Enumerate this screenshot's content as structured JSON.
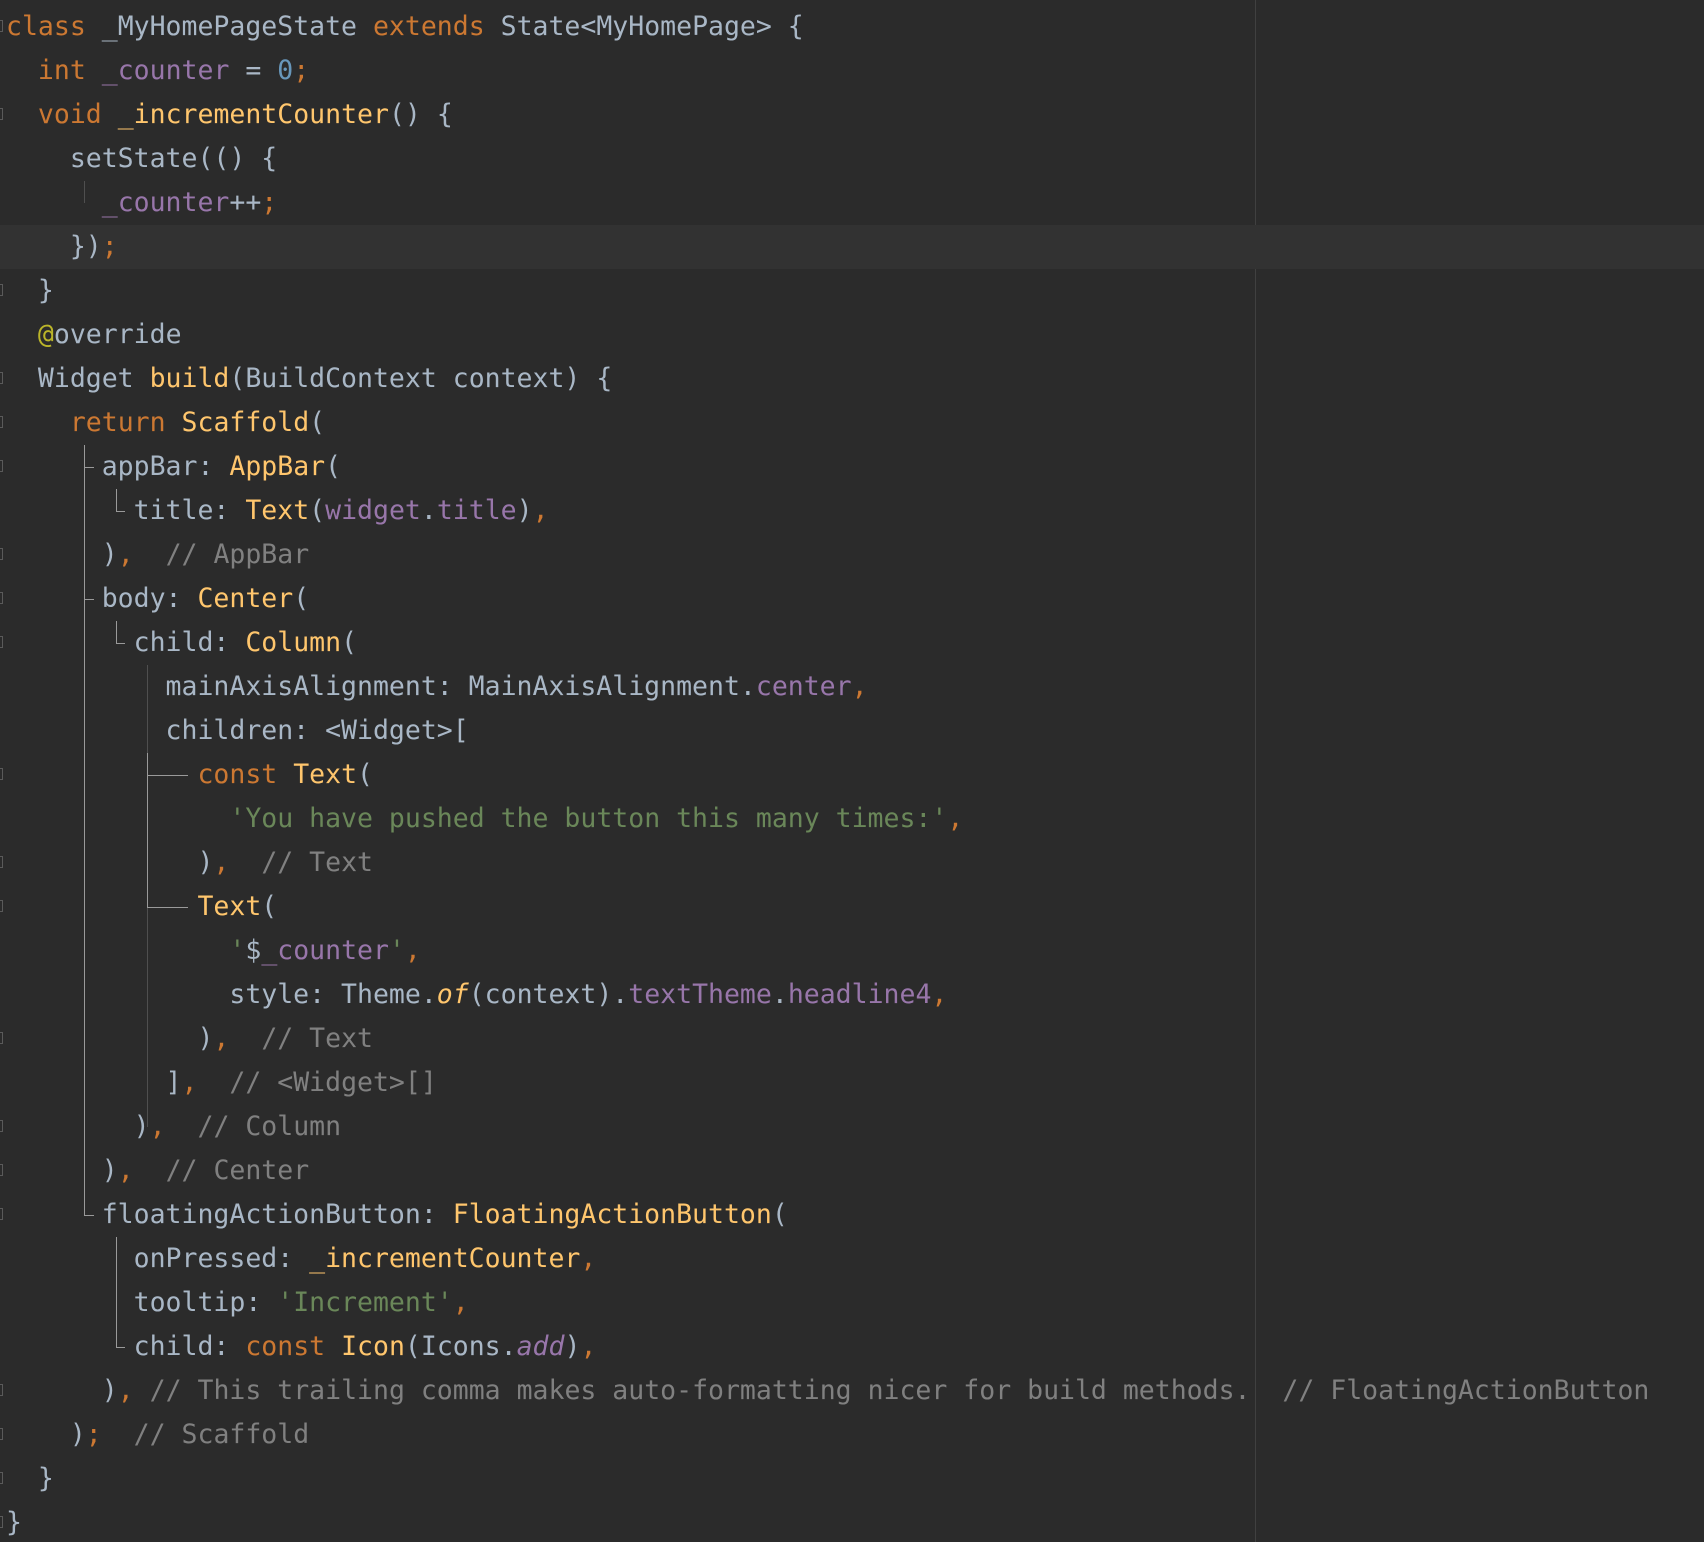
{
  "editor": {
    "language": "Dart",
    "colors": {
      "background": "#2b2b2b",
      "current_line": "#323232",
      "keyword": "#cc7832",
      "function": "#ffc66d",
      "plain": "#a9b7c6",
      "field": "#9876aa",
      "number": "#6897bb",
      "string": "#6a8759",
      "comment": "#808080",
      "annotation": "#bbb529"
    },
    "current_line_index": 5,
    "lines": [
      [
        [
          "kw",
          "class"
        ],
        [
          "pl",
          " _MyHomePageState "
        ],
        [
          "kw",
          "extends"
        ],
        [
          "pl",
          " State<MyHomePage> {"
        ]
      ],
      [
        [
          "pl",
          "  "
        ],
        [
          "kw",
          "int"
        ],
        [
          "pl",
          " "
        ],
        [
          "fd",
          "_counter"
        ],
        [
          "pl",
          " = "
        ],
        [
          "num",
          "0"
        ],
        [
          "kw",
          ";"
        ]
      ],
      [
        [
          "pl",
          "  "
        ],
        [
          "kw",
          "void"
        ],
        [
          "pl",
          " "
        ],
        [
          "fn",
          "_incrementCounter"
        ],
        [
          "pl",
          "() {"
        ]
      ],
      [
        [
          "pl",
          "    setState(() {"
        ]
      ],
      [
        [
          "pl",
          "      "
        ],
        [
          "fd",
          "_counter"
        ],
        [
          "pl",
          "++"
        ],
        [
          "kw",
          ";"
        ]
      ],
      [
        [
          "pl",
          "    })"
        ],
        [
          "kw",
          ";"
        ]
      ],
      [
        [
          "pl",
          "  }"
        ]
      ],
      [
        [
          "pl",
          "  "
        ],
        [
          "ann",
          "@"
        ],
        [
          "pl",
          "override"
        ]
      ],
      [
        [
          "pl",
          "  Widget "
        ],
        [
          "fn",
          "build"
        ],
        [
          "pl",
          "(BuildContext context) {"
        ]
      ],
      [
        [
          "pl",
          "    "
        ],
        [
          "kw",
          "return"
        ],
        [
          "pl",
          " "
        ],
        [
          "fn",
          "Scaffold"
        ],
        [
          "pl",
          "("
        ]
      ],
      [
        [
          "pl",
          "      appBar: "
        ],
        [
          "fn",
          "AppBar"
        ],
        [
          "pl",
          "("
        ]
      ],
      [
        [
          "pl",
          "        title: "
        ],
        [
          "fn",
          "Text"
        ],
        [
          "pl",
          "("
        ],
        [
          "fd",
          "widget"
        ],
        [
          "pl",
          "."
        ],
        [
          "fd",
          "title"
        ],
        [
          "pl",
          ")"
        ],
        [
          "kw",
          ","
        ]
      ],
      [
        [
          "pl",
          "      )"
        ],
        [
          "kw",
          ","
        ],
        [
          "pl",
          "  "
        ],
        [
          "cm",
          "// AppBar"
        ]
      ],
      [
        [
          "pl",
          "      body: "
        ],
        [
          "fn",
          "Center"
        ],
        [
          "pl",
          "("
        ]
      ],
      [
        [
          "pl",
          "        child: "
        ],
        [
          "fn",
          "Column"
        ],
        [
          "pl",
          "("
        ]
      ],
      [
        [
          "pl",
          "          mainAxisAlignment: MainAxisAlignment."
        ],
        [
          "fd",
          "center"
        ],
        [
          "kw",
          ","
        ]
      ],
      [
        [
          "pl",
          "          children: <Widget>["
        ]
      ],
      [
        [
          "pl",
          "            "
        ],
        [
          "kw",
          "const"
        ],
        [
          "pl",
          " "
        ],
        [
          "fn",
          "Text"
        ],
        [
          "pl",
          "("
        ]
      ],
      [
        [
          "pl",
          "              "
        ],
        [
          "str",
          "'You have pushed the button this many times:'"
        ],
        [
          "kw",
          ","
        ]
      ],
      [
        [
          "pl",
          "            )"
        ],
        [
          "kw",
          ","
        ],
        [
          "pl",
          "  "
        ],
        [
          "cm",
          "// Text"
        ]
      ],
      [
        [
          "pl",
          "            "
        ],
        [
          "fn",
          "Text"
        ],
        [
          "pl",
          "("
        ]
      ],
      [
        [
          "pl",
          "              "
        ],
        [
          "str",
          "'"
        ],
        [
          "pl",
          "$"
        ],
        [
          "fd",
          "_counter"
        ],
        [
          "str",
          "'"
        ],
        [
          "kw",
          ","
        ]
      ],
      [
        [
          "pl",
          "              style: Theme."
        ],
        [
          "fn it",
          "of"
        ],
        [
          "pl",
          "(context)."
        ],
        [
          "fd",
          "textTheme"
        ],
        [
          "pl",
          "."
        ],
        [
          "fd",
          "headline4"
        ],
        [
          "kw",
          ","
        ]
      ],
      [
        [
          "pl",
          "            )"
        ],
        [
          "kw",
          ","
        ],
        [
          "pl",
          "  "
        ],
        [
          "cm",
          "// Text"
        ]
      ],
      [
        [
          "pl",
          "          ]"
        ],
        [
          "kw",
          ","
        ],
        [
          "pl",
          "  "
        ],
        [
          "cm",
          "// <Widget>[]"
        ]
      ],
      [
        [
          "pl",
          "        )"
        ],
        [
          "kw",
          ","
        ],
        [
          "pl",
          "  "
        ],
        [
          "cm",
          "// Column"
        ]
      ],
      [
        [
          "pl",
          "      )"
        ],
        [
          "kw",
          ","
        ],
        [
          "pl",
          "  "
        ],
        [
          "cm",
          "// Center"
        ]
      ],
      [
        [
          "pl",
          "      floatingActionButton: "
        ],
        [
          "fn",
          "FloatingActionButton"
        ],
        [
          "pl",
          "("
        ]
      ],
      [
        [
          "pl",
          "        onPressed: "
        ],
        [
          "fn",
          "_incrementCounter"
        ],
        [
          "kw",
          ","
        ]
      ],
      [
        [
          "pl",
          "        tooltip: "
        ],
        [
          "str",
          "'Increment'"
        ],
        [
          "kw",
          ","
        ]
      ],
      [
        [
          "pl",
          "        child: "
        ],
        [
          "kw",
          "const"
        ],
        [
          "pl",
          " "
        ],
        [
          "fn",
          "Icon"
        ],
        [
          "pl",
          "(Icons."
        ],
        [
          "fd it",
          "add"
        ],
        [
          "pl",
          ")"
        ],
        [
          "kw",
          ","
        ]
      ],
      [
        [
          "pl",
          "      )"
        ],
        [
          "kw",
          ","
        ],
        [
          "pl",
          " "
        ],
        [
          "cm",
          "// This trailing comma makes auto-formatting nicer for build methods."
        ],
        [
          "pl",
          "  "
        ],
        [
          "cm",
          "// FloatingActionButton"
        ]
      ],
      [
        [
          "pl",
          "    )"
        ],
        [
          "kw",
          ";"
        ],
        [
          "pl",
          "  "
        ],
        [
          "cm",
          "// Scaffold"
        ]
      ],
      [
        [
          "pl",
          "  }"
        ]
      ],
      [
        [
          "pl",
          "}"
        ]
      ]
    ]
  }
}
